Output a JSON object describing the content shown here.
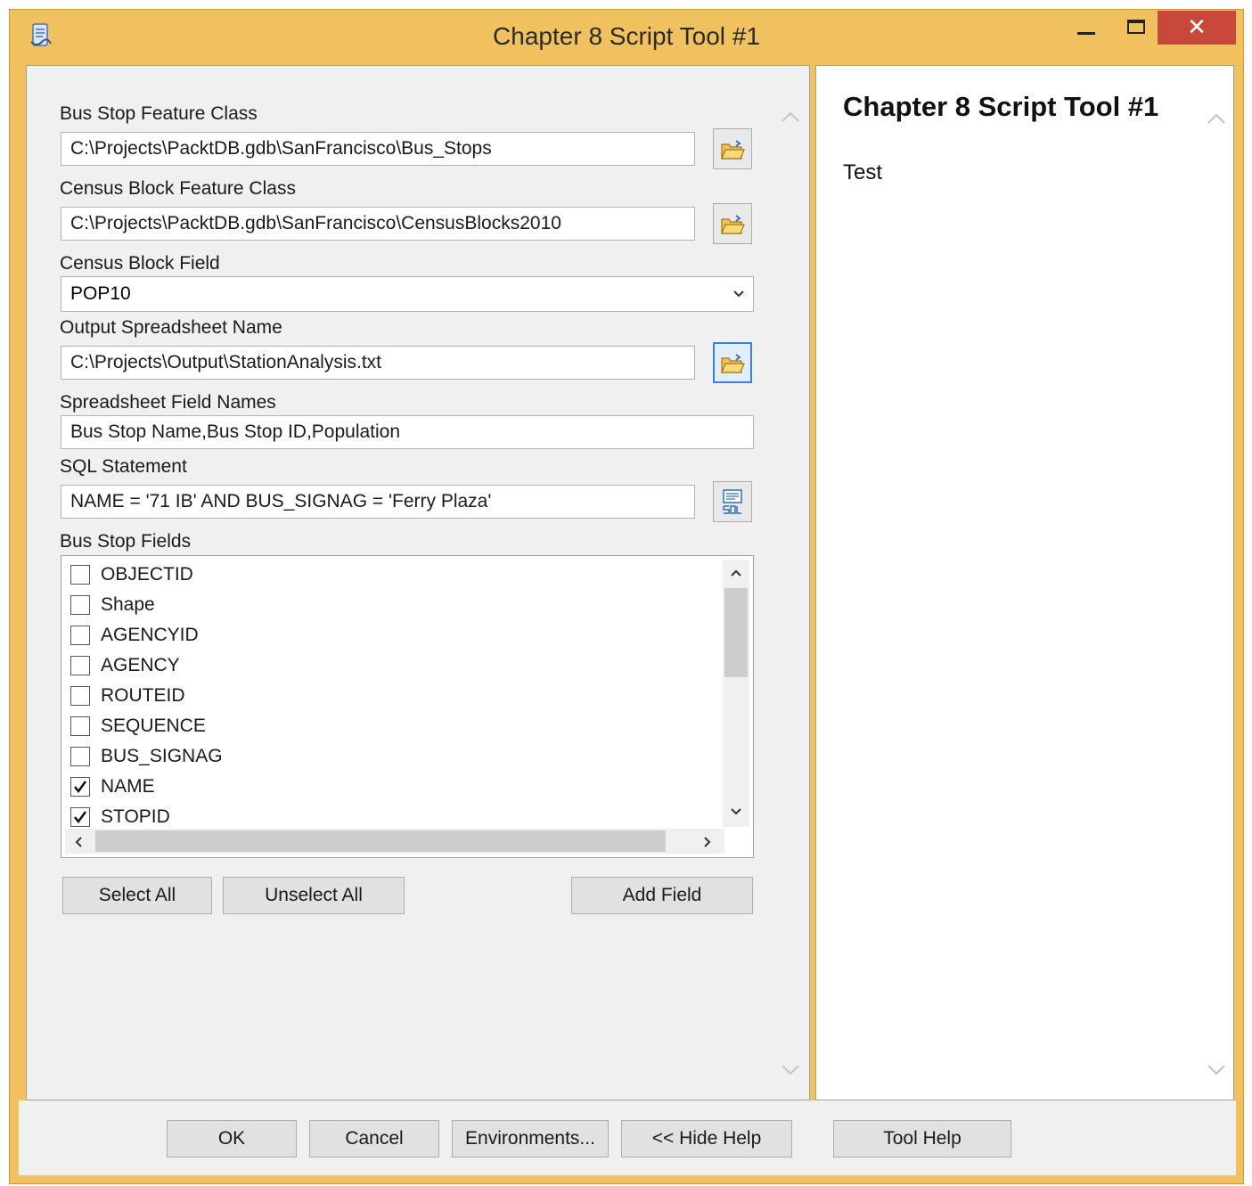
{
  "window": {
    "title": "Chapter 8 Script Tool #1",
    "close_glyph": "✕"
  },
  "form": {
    "bus_stop_fc": {
      "label": "Bus Stop Feature Class",
      "value": "C:\\Projects\\PacktDB.gdb\\SanFrancisco\\Bus_Stops"
    },
    "census_block_fc": {
      "label": "Census Block Feature Class",
      "value": "C:\\Projects\\PacktDB.gdb\\SanFrancisco\\CensusBlocks2010"
    },
    "census_block_field": {
      "label": "Census Block Field",
      "value": "POP10"
    },
    "output_spreadsheet": {
      "label": "Output Spreadsheet Name",
      "value": "C:\\Projects\\Output\\StationAnalysis.txt"
    },
    "spreadsheet_fields": {
      "label": "Spreadsheet Field Names",
      "value": "Bus Stop Name,Bus Stop ID,Population"
    },
    "sql_statement": {
      "label": "SQL Statement",
      "value": "NAME = '71 IB' AND BUS_SIGNAG = 'Ferry Plaza'"
    },
    "bus_stop_fields": {
      "label": "Bus Stop Fields",
      "items": [
        {
          "name": "OBJECTID",
          "checked": false
        },
        {
          "name": "Shape",
          "checked": false
        },
        {
          "name": "AGENCYID",
          "checked": false
        },
        {
          "name": "AGENCY",
          "checked": false
        },
        {
          "name": "ROUTEID",
          "checked": false
        },
        {
          "name": "SEQUENCE",
          "checked": false
        },
        {
          "name": "BUS_SIGNAG",
          "checked": false
        },
        {
          "name": "NAME",
          "checked": true
        },
        {
          "name": "STOPID",
          "checked": true
        }
      ]
    },
    "buttons": {
      "select_all": "Select All",
      "unselect_all": "Unselect All",
      "add_field": "Add Field"
    }
  },
  "help": {
    "title": "Chapter 8 Script Tool #1",
    "text": "Test"
  },
  "bottom": {
    "ok": "OK",
    "cancel": "Cancel",
    "environments": "Environments...",
    "hide_help": "<< Hide Help",
    "tool_help": "Tool Help"
  },
  "icons": {
    "app": "script-icon",
    "browse": "open-folder-icon",
    "sql": "sql-icon"
  }
}
